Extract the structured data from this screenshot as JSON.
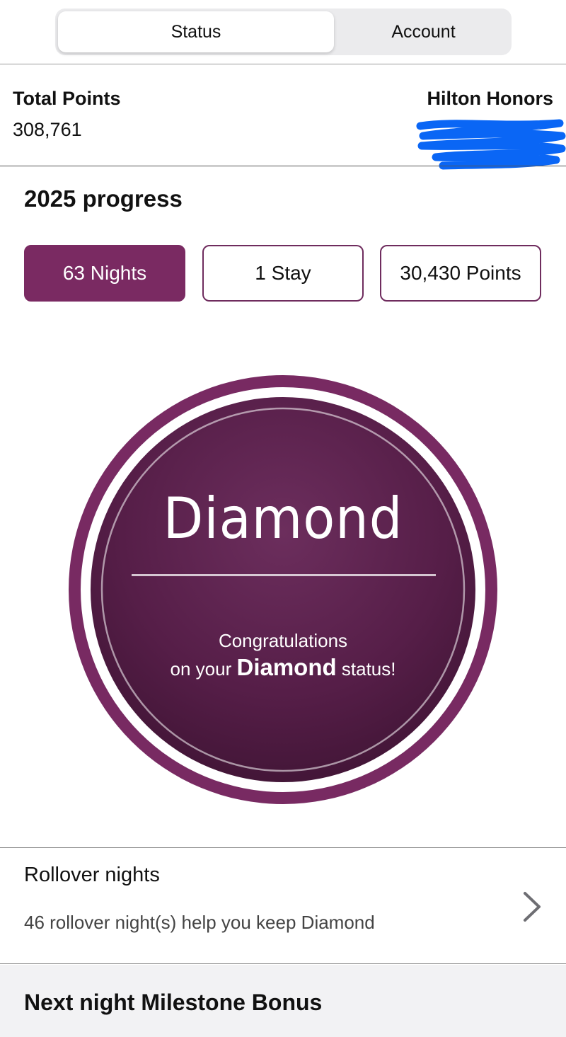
{
  "tabs": [
    {
      "label": "Status",
      "active": true
    },
    {
      "label": "Account",
      "active": false
    }
  ],
  "points": {
    "total_label": "Total Points",
    "total_value": "308,761",
    "program_label": "Hilton Honors"
  },
  "progress": {
    "title": "2025 progress",
    "pills": [
      {
        "label": "63 Nights",
        "selected": true
      },
      {
        "label": "1 Stay",
        "selected": false
      },
      {
        "label": "30,430 Points",
        "selected": false
      }
    ]
  },
  "badge": {
    "tier": "Diamond",
    "message_line1": "Congratulations",
    "message_prefix": "on your",
    "message_tier": "Diamond",
    "message_suffix": "status!"
  },
  "rollover": {
    "title": "Rollover nights",
    "subtitle": "46 rollover night(s) help you keep Diamond",
    "icon": "chevron-right-icon"
  },
  "milestone": {
    "title": "Next night Milestone Bonus"
  },
  "colors": {
    "brand_plum": "#7a2a62",
    "badge_dark": "#4d1a41",
    "redaction_blue": "#0a66f5"
  }
}
